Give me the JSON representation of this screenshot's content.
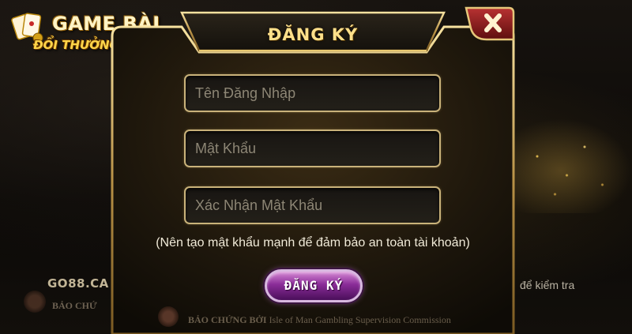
{
  "logo": {
    "line1": "GAME BÀI",
    "line2": "ĐỔI THƯỞNG UK"
  },
  "background": {
    "site_link": "GO88.CA",
    "side_text": "để kiểm tra",
    "left_footer": "BẢO CHỨ"
  },
  "dialog": {
    "title": "ĐĂNG KÝ",
    "username_placeholder": "Tên Đăng Nhập",
    "password_placeholder": "Mật Khẩu",
    "confirm_placeholder": "Xác Nhận Mật Khẩu",
    "hint": "(Nên tạo mật khẩu mạnh để đảm bảo an toàn tài khoản)",
    "submit_label": "ĐĂNG KÝ",
    "footer_label": "BẢO CHỨNG BỞI",
    "footer_org": "Isle of Man Gambling Supervision Commission"
  },
  "icons": {
    "close": "close-icon",
    "seal": "seal-icon",
    "cards": "playing-cards-icon"
  },
  "colors": {
    "gold_border": "#c9b27a",
    "title_gold": "#ffe08a",
    "close_red": "#8e1d1d",
    "submit_purple": "#8a2c98"
  }
}
